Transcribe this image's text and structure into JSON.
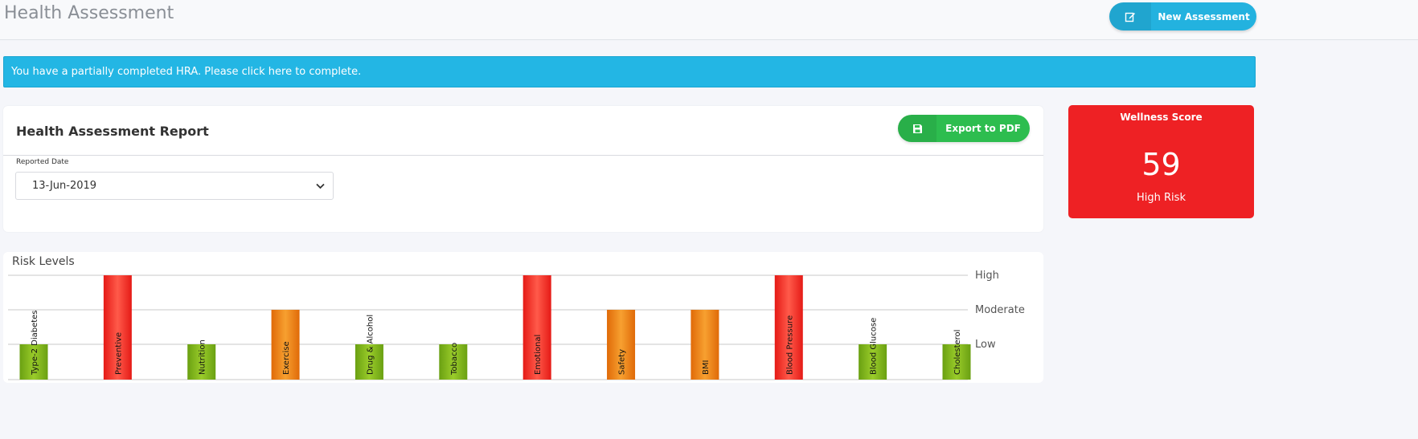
{
  "header": {
    "title": "Health Assessment",
    "new_assessment_label": "New Assessment",
    "new_assessment_icon": "edit-icon"
  },
  "alert": {
    "text": "You have a partially completed HRA. Please click here to complete."
  },
  "report": {
    "title": "Health Assessment Report",
    "export_label": "Export to PDF",
    "export_icon": "save-icon",
    "date_label": "Reported Date",
    "date_value": "13-Jun-2019"
  },
  "wellness": {
    "title": "Wellness Score",
    "score": "59",
    "risk": "High Risk",
    "color": "#ee2124"
  },
  "risk_levels": {
    "title": "Risk Levels"
  },
  "colors": {
    "accent_blue": "#23b2df",
    "export_green": "#2dbd4f",
    "low": "#7fb51b",
    "moderate": "#f08a10",
    "high": "#f2231f"
  },
  "chart_data": {
    "type": "bar",
    "title": "Risk Levels",
    "y_levels": [
      "Low",
      "Moderate",
      "High"
    ],
    "categories": [
      "Type-2 Diabetes",
      "Preventive",
      "Nutrition",
      "Exercise",
      "Drug & Alcohol",
      "Tobacco",
      "Emotional",
      "Safety",
      "BMI",
      "Blood Pressure",
      "Blood Glucose",
      "Cholesterol"
    ],
    "values": [
      "Low",
      "High",
      "Low",
      "Moderate",
      "Low",
      "Low",
      "High",
      "Moderate",
      "Moderate",
      "High",
      "Low",
      "Low"
    ],
    "grid": true
  }
}
